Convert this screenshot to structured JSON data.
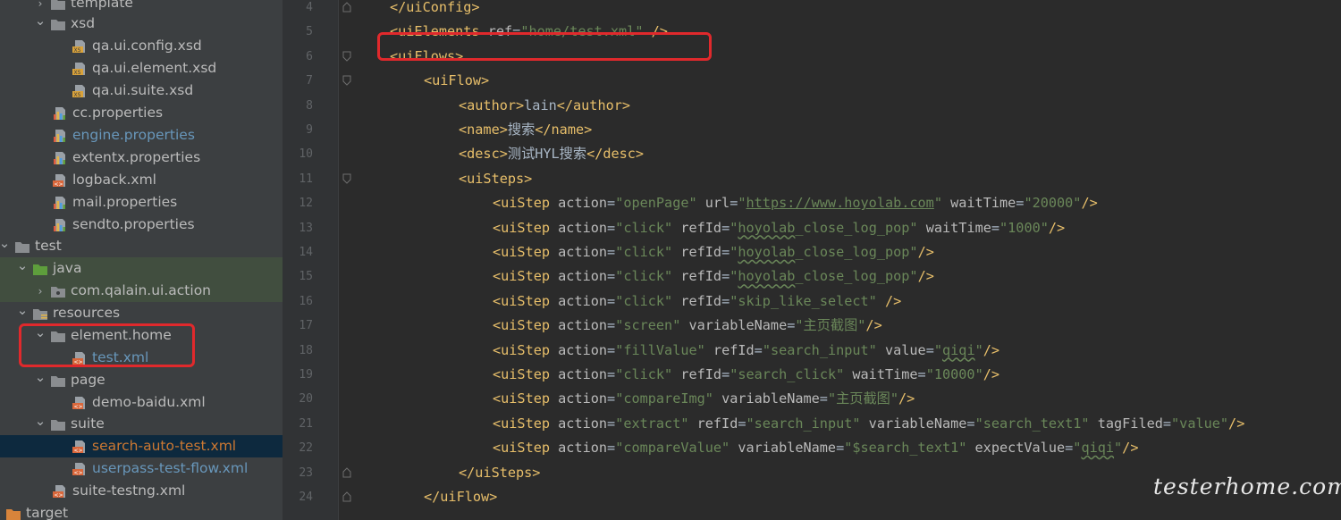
{
  "project_tree": {
    "items": [
      {
        "label": "template",
        "expanded": false,
        "type": "folder"
      },
      {
        "label": "xsd",
        "expanded": true,
        "type": "folder"
      },
      {
        "label": "qa.ui.config.xsd",
        "type": "xsd"
      },
      {
        "label": "qa.ui.element.xsd",
        "type": "xsd"
      },
      {
        "label": "qa.ui.suite.xsd",
        "type": "xsd"
      },
      {
        "label": "cc.properties",
        "type": "properties"
      },
      {
        "label": "engine.properties",
        "type": "properties",
        "color": "#6897bb"
      },
      {
        "label": "extentx.properties",
        "type": "properties"
      },
      {
        "label": "logback.xml",
        "type": "xml"
      },
      {
        "label": "mail.properties",
        "type": "properties"
      },
      {
        "label": "sendto.properties",
        "type": "properties"
      },
      {
        "label": "test",
        "expanded": true,
        "type": "folder"
      },
      {
        "label": "java",
        "expanded": true,
        "type": "src-folder"
      },
      {
        "label": "com.qalain.ui.action",
        "expanded": false,
        "type": "package"
      },
      {
        "label": "resources",
        "expanded": true,
        "type": "res-folder"
      },
      {
        "label": "element.home",
        "expanded": true,
        "type": "folder"
      },
      {
        "label": "test.xml",
        "type": "xml",
        "color": "#6897bb"
      },
      {
        "label": "page",
        "expanded": true,
        "type": "folder"
      },
      {
        "label": "demo-baidu.xml",
        "type": "xml"
      },
      {
        "label": "suite",
        "expanded": true,
        "type": "folder"
      },
      {
        "label": "search-auto-test.xml",
        "type": "xml",
        "color": "#cc7832"
      },
      {
        "label": "userpass-test-flow.xml",
        "type": "xml",
        "color": "#6897bb"
      },
      {
        "label": "suite-testng.xml",
        "type": "xml"
      },
      {
        "label": "target",
        "type": "target-folder"
      }
    ]
  },
  "editor": {
    "line_numbers": [
      "4",
      "5",
      "6",
      "7",
      "8",
      "9",
      "10",
      "11",
      "12",
      "13",
      "14",
      "15",
      "16",
      "17",
      "18",
      "19",
      "20",
      "21",
      "22",
      "23",
      "24"
    ],
    "lines": [
      [
        {
          "c": "tag",
          "t": "</uiConfig>"
        }
      ],
      [
        {
          "c": "tag",
          "t": "<uiElements "
        },
        {
          "c": "attr",
          "t": "ref"
        },
        {
          "c": "txt",
          "t": "="
        },
        {
          "c": "str",
          "t": "\"home/test.xml\""
        },
        {
          "c": "tag",
          "t": " />"
        }
      ],
      [
        {
          "c": "tag",
          "t": "<uiFlows>"
        }
      ],
      [
        {
          "c": "tag",
          "t": "<uiFlow>"
        }
      ],
      [
        {
          "c": "tag",
          "t": "<author>"
        },
        {
          "c": "txt",
          "t": "lain"
        },
        {
          "c": "tag",
          "t": "</author>"
        }
      ],
      [
        {
          "c": "tag",
          "t": "<name>"
        },
        {
          "c": "txt",
          "t": "搜索"
        },
        {
          "c": "tag",
          "t": "</name>"
        }
      ],
      [
        {
          "c": "tag",
          "t": "<desc>"
        },
        {
          "c": "txt",
          "t": "测试HYL搜索"
        },
        {
          "c": "tag",
          "t": "</desc>"
        }
      ],
      [
        {
          "c": "tag",
          "t": "<uiSteps>"
        }
      ],
      [
        {
          "c": "tag",
          "t": "<uiStep "
        },
        {
          "c": "attr",
          "t": "action"
        },
        {
          "c": "txt",
          "t": "="
        },
        {
          "c": "str",
          "t": "\"openPage\""
        },
        {
          "c": "attr",
          "t": " url"
        },
        {
          "c": "txt",
          "t": "="
        },
        {
          "c": "str",
          "t": "\""
        },
        {
          "c": "url",
          "t": "https://www.hoyolab.com"
        },
        {
          "c": "str",
          "t": "\""
        },
        {
          "c": "attr",
          "t": " waitTime"
        },
        {
          "c": "txt",
          "t": "="
        },
        {
          "c": "str",
          "t": "\"20000\""
        },
        {
          "c": "tag",
          "t": "/>"
        }
      ],
      [
        {
          "c": "tag",
          "t": "<uiStep "
        },
        {
          "c": "attr",
          "t": "action"
        },
        {
          "c": "txt",
          "t": "="
        },
        {
          "c": "str",
          "t": "\"click\""
        },
        {
          "c": "attr",
          "t": " refId"
        },
        {
          "c": "txt",
          "t": "="
        },
        {
          "c": "str",
          "t": "\""
        },
        {
          "c": "str wavy",
          "t": "hoyolab"
        },
        {
          "c": "str",
          "t": "_close_log_pop\""
        },
        {
          "c": "attr",
          "t": " waitTime"
        },
        {
          "c": "txt",
          "t": "="
        },
        {
          "c": "str",
          "t": "\"1000\""
        },
        {
          "c": "tag",
          "t": "/>"
        }
      ],
      [
        {
          "c": "tag",
          "t": "<uiStep "
        },
        {
          "c": "attr",
          "t": "action"
        },
        {
          "c": "txt",
          "t": "="
        },
        {
          "c": "str",
          "t": "\"click\""
        },
        {
          "c": "attr",
          "t": " refId"
        },
        {
          "c": "txt",
          "t": "="
        },
        {
          "c": "str",
          "t": "\""
        },
        {
          "c": "str wavy",
          "t": "hoyolab"
        },
        {
          "c": "str",
          "t": "_close_log_pop\""
        },
        {
          "c": "tag",
          "t": "/>"
        }
      ],
      [
        {
          "c": "tag",
          "t": "<uiStep "
        },
        {
          "c": "attr",
          "t": "action"
        },
        {
          "c": "txt",
          "t": "="
        },
        {
          "c": "str",
          "t": "\"click\""
        },
        {
          "c": "attr",
          "t": " refId"
        },
        {
          "c": "txt",
          "t": "="
        },
        {
          "c": "str",
          "t": "\""
        },
        {
          "c": "str wavy",
          "t": "hoyolab"
        },
        {
          "c": "str",
          "t": "_close_log_pop\""
        },
        {
          "c": "tag",
          "t": "/>"
        }
      ],
      [
        {
          "c": "tag",
          "t": "<uiStep "
        },
        {
          "c": "attr",
          "t": "action"
        },
        {
          "c": "txt",
          "t": "="
        },
        {
          "c": "str",
          "t": "\"click\""
        },
        {
          "c": "attr",
          "t": " refId"
        },
        {
          "c": "txt",
          "t": "="
        },
        {
          "c": "str",
          "t": "\"skip_like_select\""
        },
        {
          "c": "tag",
          "t": " />"
        }
      ],
      [
        {
          "c": "tag",
          "t": "<uiStep "
        },
        {
          "c": "attr",
          "t": "action"
        },
        {
          "c": "txt",
          "t": "="
        },
        {
          "c": "str",
          "t": "\"screen\""
        },
        {
          "c": "attr",
          "t": " variableName"
        },
        {
          "c": "txt",
          "t": "="
        },
        {
          "c": "str",
          "t": "\"主页截图\""
        },
        {
          "c": "tag",
          "t": "/>"
        }
      ],
      [
        {
          "c": "tag",
          "t": "<uiStep "
        },
        {
          "c": "attr",
          "t": "action"
        },
        {
          "c": "txt",
          "t": "="
        },
        {
          "c": "str",
          "t": "\"fillValue\""
        },
        {
          "c": "attr",
          "t": " refId"
        },
        {
          "c": "txt",
          "t": "="
        },
        {
          "c": "str",
          "t": "\"search_input\""
        },
        {
          "c": "attr",
          "t": " value"
        },
        {
          "c": "txt",
          "t": "="
        },
        {
          "c": "str",
          "t": "\""
        },
        {
          "c": "str wavy",
          "t": "qiqi"
        },
        {
          "c": "str",
          "t": "\""
        },
        {
          "c": "tag",
          "t": "/>"
        }
      ],
      [
        {
          "c": "tag",
          "t": "<uiStep "
        },
        {
          "c": "attr",
          "t": "action"
        },
        {
          "c": "txt",
          "t": "="
        },
        {
          "c": "str",
          "t": "\"click\""
        },
        {
          "c": "attr",
          "t": " refId"
        },
        {
          "c": "txt",
          "t": "="
        },
        {
          "c": "str",
          "t": "\"search_click\""
        },
        {
          "c": "attr",
          "t": " waitTime"
        },
        {
          "c": "txt",
          "t": "="
        },
        {
          "c": "str",
          "t": "\"10000\""
        },
        {
          "c": "tag",
          "t": "/>"
        }
      ],
      [
        {
          "c": "tag",
          "t": "<uiStep "
        },
        {
          "c": "attr",
          "t": "action"
        },
        {
          "c": "txt",
          "t": "="
        },
        {
          "c": "str",
          "t": "\"compareImg\""
        },
        {
          "c": "attr",
          "t": " variableName"
        },
        {
          "c": "txt",
          "t": "="
        },
        {
          "c": "str",
          "t": "\"主页截图\""
        },
        {
          "c": "tag",
          "t": "/>"
        }
      ],
      [
        {
          "c": "tag",
          "t": "<uiStep "
        },
        {
          "c": "attr",
          "t": "action"
        },
        {
          "c": "txt",
          "t": "="
        },
        {
          "c": "str",
          "t": "\"extract\""
        },
        {
          "c": "attr",
          "t": " refId"
        },
        {
          "c": "txt",
          "t": "="
        },
        {
          "c": "str",
          "t": "\"search_input\""
        },
        {
          "c": "attr",
          "t": " variableName"
        },
        {
          "c": "txt",
          "t": "="
        },
        {
          "c": "str",
          "t": "\"search_text1\""
        },
        {
          "c": "attr",
          "t": " tagFiled"
        },
        {
          "c": "txt",
          "t": "="
        },
        {
          "c": "str",
          "t": "\"value\""
        },
        {
          "c": "tag",
          "t": "/>"
        }
      ],
      [
        {
          "c": "tag",
          "t": "<uiStep "
        },
        {
          "c": "attr",
          "t": "action"
        },
        {
          "c": "txt",
          "t": "="
        },
        {
          "c": "str",
          "t": "\"compareValue\""
        },
        {
          "c": "attr",
          "t": " variableName"
        },
        {
          "c": "txt",
          "t": "="
        },
        {
          "c": "str",
          "t": "\"$search_text1\""
        },
        {
          "c": "attr",
          "t": " expectValue"
        },
        {
          "c": "txt",
          "t": "="
        },
        {
          "c": "str",
          "t": "\""
        },
        {
          "c": "str wavy",
          "t": "qiqi"
        },
        {
          "c": "str",
          "t": "\""
        },
        {
          "c": "tag",
          "t": "/>"
        }
      ],
      [
        {
          "c": "tag",
          "t": "</uiSteps>"
        }
      ],
      [
        {
          "c": "tag",
          "t": "</uiFlow>"
        }
      ]
    ]
  },
  "watermark": "testerhome.com",
  "colors": {
    "sidebar_bg": "#3c3f41",
    "editor_bg": "#2b2b2b",
    "tag": "#e8bf6a",
    "string": "#6a8759",
    "highlight_box": "#e0292c"
  }
}
